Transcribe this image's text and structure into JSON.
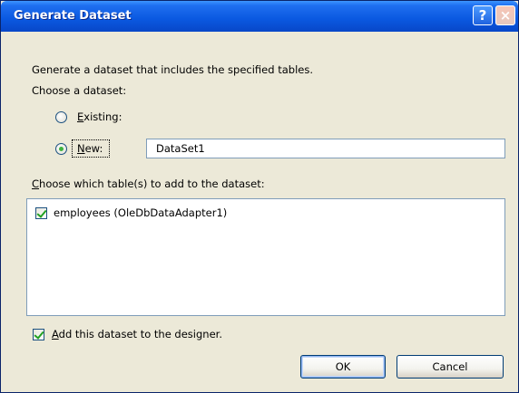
{
  "window": {
    "title": "Generate Dataset",
    "help_glyph": "?",
    "close_glyph": "×"
  },
  "description": "Generate a dataset that includes the specified tables.",
  "choose_dataset_label": "Choose a dataset:",
  "existing_option": {
    "mnemonic": "E",
    "rest": "xisting:",
    "selected": false
  },
  "new_option": {
    "mnemonic": "N",
    "rest": "ew:",
    "selected": true,
    "value": "DataSet1"
  },
  "tables_label": {
    "mnemonic": "C",
    "rest": "hoose which table(s) to add to the dataset:"
  },
  "tables": [
    {
      "label": "employees (OleDbDataAdapter1)",
      "checked": true
    }
  ],
  "add_to_designer": {
    "mnemonic": "A",
    "rest": "dd this dataset to the designer.",
    "checked": true
  },
  "buttons": {
    "ok": "OK",
    "cancel": "Cancel"
  },
  "colors": {
    "titlebar": "#0a58e0",
    "dialog_bg": "#ece9d8",
    "field_border": "#7f9db9",
    "check_green": "#21a121"
  }
}
